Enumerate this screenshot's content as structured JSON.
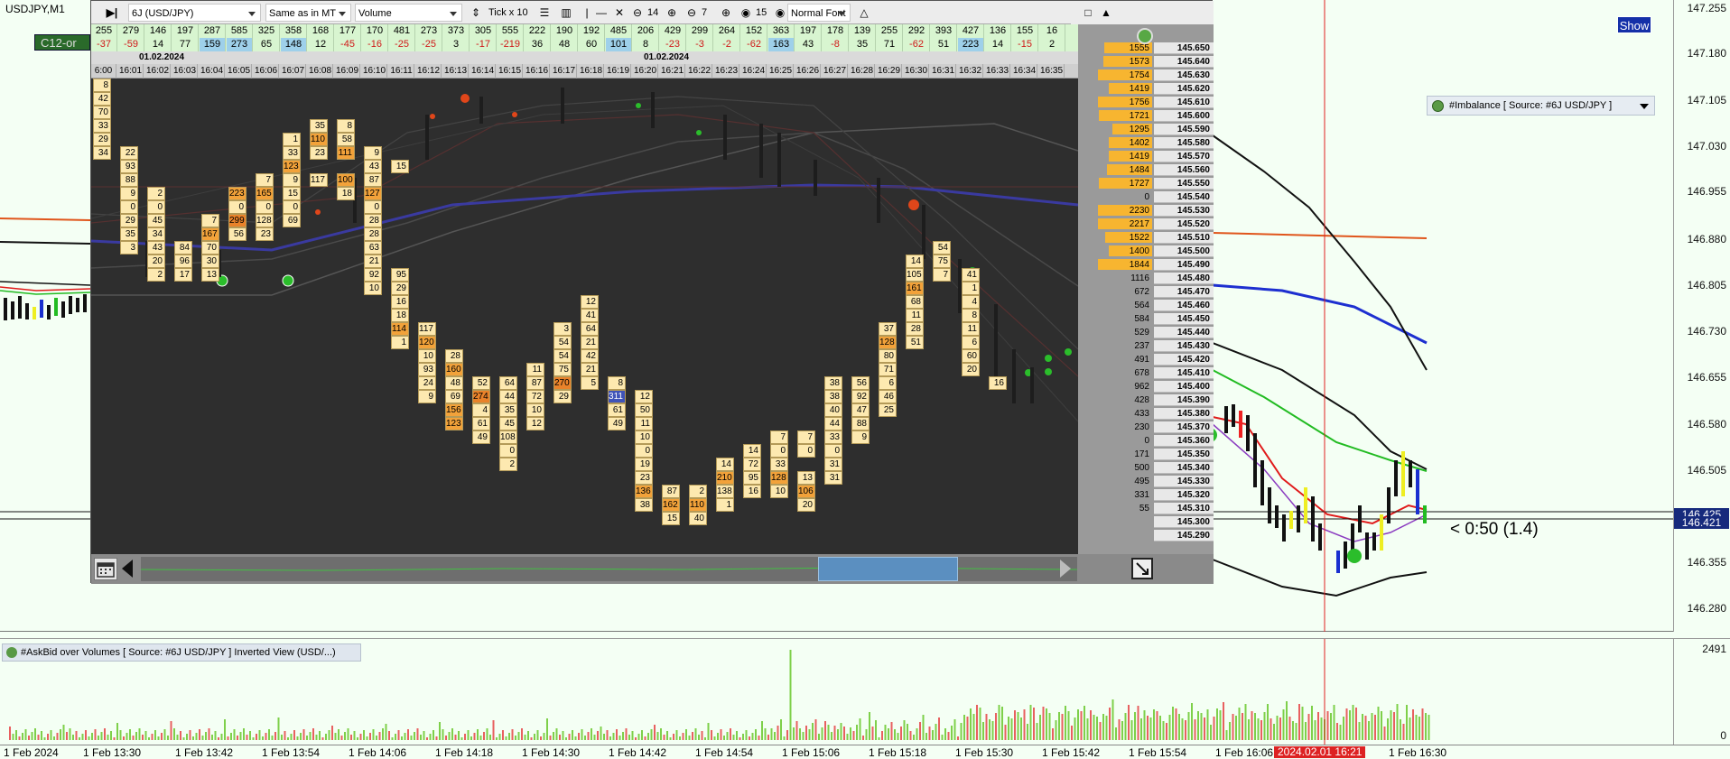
{
  "main": {
    "symbol_title": "USDJPY,M1",
    "show_button": "Show",
    "timer_text": "< 0:50 (1.4)",
    "price_labels": [
      "147.255",
      "147.180",
      "147.105",
      "147.030",
      "146.955",
      "146.880",
      "146.805",
      "146.730",
      "146.655",
      "146.580",
      "146.505",
      "146.425",
      "146.421",
      "146.355",
      "146.280"
    ],
    "bid_tags": [
      "146.425",
      "146.421"
    ],
    "imbalance_title": "#Imbalance [ Source: #6J USD/JPY ]"
  },
  "toolbar": {
    "instrument": "6J (USD/JPY)",
    "scale_mode": "Same as in MT",
    "data_type": "Volume",
    "tick_mode": "Tick x 10",
    "zoom_value": "14",
    "step_value": "7",
    "count_value": "15",
    "font_mode": "Normal Font"
  },
  "stats": {
    "row1": [
      "255",
      "279",
      "146",
      "197",
      "287",
      "585",
      "325",
      "358",
      "168",
      "177",
      "170",
      "481",
      "273",
      "373",
      "305",
      "555",
      "222",
      "190",
      "192",
      "485",
      "206",
      "429",
      "299",
      "264",
      "152",
      "363",
      "197",
      "178",
      "139",
      "255",
      "292",
      "393",
      "427",
      "136",
      "155",
      "16"
    ],
    "row2": [
      "-37",
      "-59",
      "14",
      "77",
      "159",
      "273",
      "65",
      "148",
      "12",
      "-45",
      "-16",
      "-25",
      "-25",
      "3",
      "-17",
      "-219",
      "36",
      "48",
      "60",
      "101",
      "8",
      "-23",
      "-3",
      "-2",
      "-62",
      "163",
      "43",
      "-8",
      "35",
      "71",
      "-62",
      "51",
      "223",
      "14",
      "-15",
      "2"
    ],
    "c12_label": "C12-or"
  },
  "dates": {
    "d1": "01.02.2024",
    "d2": "01.02.2024"
  },
  "times": [
    "6:00",
    "16:01",
    "16:02",
    "16:03",
    "16:04",
    "16:05",
    "16:06",
    "16:07",
    "16:08",
    "16:09",
    "16:10",
    "16:11",
    "16:12",
    "16:13",
    "16:14",
    "16:15",
    "16:16",
    "16:17",
    "16:18",
    "16:19",
    "16:20",
    "16:21",
    "16:22",
    "16:23",
    "16:24",
    "16:25",
    "16:26",
    "16:27",
    "16:28",
    "16:29",
    "16:30",
    "16:31",
    "16:32",
    "16:33",
    "16:34",
    "16:35"
  ],
  "ladder": [
    {
      "vol": "1555",
      "price": "145.650",
      "bar": 0.88
    },
    {
      "vol": "1573",
      "price": "145.640",
      "bar": 0.9
    },
    {
      "vol": "1754",
      "price": "145.630",
      "bar": 1.0
    },
    {
      "vol": "1419",
      "price": "145.620",
      "bar": 0.8
    },
    {
      "vol": "1756",
      "price": "145.610",
      "bar": 1.0
    },
    {
      "vol": "1721",
      "price": "145.600",
      "bar": 0.98
    },
    {
      "vol": "1295",
      "price": "145.590",
      "bar": 0.74
    },
    {
      "vol": "1402",
      "price": "145.580",
      "bar": 0.8
    },
    {
      "vol": "1419",
      "price": "145.570",
      "bar": 0.8
    },
    {
      "vol": "1484",
      "price": "145.560",
      "bar": 0.84
    },
    {
      "vol": "1727",
      "price": "145.550",
      "bar": 0.98
    },
    {
      "vol": "0",
      "price": "145.540",
      "bar": 0
    },
    {
      "vol": "2230",
      "price": "145.530",
      "bar": 1.0
    },
    {
      "vol": "2217",
      "price": "145.520",
      "bar": 1.0
    },
    {
      "vol": "1522",
      "price": "145.510",
      "bar": 0.86
    },
    {
      "vol": "1400",
      "price": "145.500",
      "bar": 0.8
    },
    {
      "vol": "1844",
      "price": "145.490",
      "bar": 1.0
    },
    {
      "vol": "1116",
      "price": "145.480",
      "bar": 0
    },
    {
      "vol": "672",
      "price": "145.470",
      "bar": 0
    },
    {
      "vol": "564",
      "price": "145.460",
      "bar": 0
    },
    {
      "vol": "584",
      "price": "145.450",
      "bar": 0
    },
    {
      "vol": "529",
      "price": "145.440",
      "bar": 0
    },
    {
      "vol": "237",
      "price": "145.430",
      "bar": 0
    },
    {
      "vol": "491",
      "price": "145.420",
      "bar": 0
    },
    {
      "vol": "678",
      "price": "145.410",
      "bar": 0
    },
    {
      "vol": "962",
      "price": "145.400",
      "bar": 0
    },
    {
      "vol": "428",
      "price": "145.390",
      "bar": 0
    },
    {
      "vol": "433",
      "price": "145.380",
      "bar": 0
    },
    {
      "vol": "230",
      "price": "145.370",
      "bar": 0
    },
    {
      "vol": "0",
      "price": "145.360",
      "bar": 0
    },
    {
      "vol": "171",
      "price": "145.350",
      "bar": 0
    },
    {
      "vol": "500",
      "price": "145.340",
      "bar": 0
    },
    {
      "vol": "495",
      "price": "145.330",
      "bar": 0
    },
    {
      "vol": "331",
      "price": "145.320",
      "bar": 0
    },
    {
      "vol": "55",
      "price": "145.310",
      "bar": 0
    },
    {
      "vol": "",
      "price": "145.300",
      "bar": 0
    },
    {
      "vol": "",
      "price": "145.290",
      "bar": 0
    }
  ],
  "footprint_cells": [
    {
      "c": 0,
      "r": 0,
      "v": "8"
    },
    {
      "c": 0,
      "r": 1,
      "v": "42"
    },
    {
      "c": 0,
      "r": 2,
      "v": "70"
    },
    {
      "c": 0,
      "r": 3,
      "v": "33"
    },
    {
      "c": 0,
      "r": 4,
      "v": "29"
    },
    {
      "c": 0,
      "r": 5,
      "v": "34"
    },
    {
      "c": 1,
      "r": 5,
      "v": "22"
    },
    {
      "c": 1,
      "r": 6,
      "v": "93"
    },
    {
      "c": 1,
      "r": 7,
      "v": "88"
    },
    {
      "c": 1,
      "r": 8,
      "v": "9"
    },
    {
      "c": 1,
      "r": 9,
      "v": "0"
    },
    {
      "c": 1,
      "r": 10,
      "v": "29"
    },
    {
      "c": 1,
      "r": 11,
      "v": "35"
    },
    {
      "c": 1,
      "r": 12,
      "v": "3"
    },
    {
      "c": 2,
      "r": 8,
      "v": "2"
    },
    {
      "c": 2,
      "r": 9,
      "v": "0"
    },
    {
      "c": 2,
      "r": 10,
      "v": "45"
    },
    {
      "c": 2,
      "r": 11,
      "v": "34"
    },
    {
      "c": 2,
      "r": 12,
      "v": "43"
    },
    {
      "c": 2,
      "r": 13,
      "v": "20"
    },
    {
      "c": 2,
      "r": 14,
      "v": "2"
    },
    {
      "c": 3,
      "r": 12,
      "v": "84"
    },
    {
      "c": 3,
      "r": 13,
      "v": "96"
    },
    {
      "c": 3,
      "r": 14,
      "v": "17"
    },
    {
      "c": 4,
      "r": 10,
      "v": "7"
    },
    {
      "c": 4,
      "r": 11,
      "v": "167",
      "h": 1
    },
    {
      "c": 4,
      "r": 12,
      "v": "70"
    },
    {
      "c": 4,
      "r": 13,
      "v": "30"
    },
    {
      "c": 4,
      "r": 14,
      "v": "13"
    },
    {
      "c": 5,
      "r": 8,
      "v": "223",
      "h": 1
    },
    {
      "c": 5,
      "r": 9,
      "v": "0"
    },
    {
      "c": 5,
      "r": 10,
      "v": "299",
      "h": 2
    },
    {
      "c": 5,
      "r": 11,
      "v": "56"
    },
    {
      "c": 6,
      "r": 7,
      "v": "7"
    },
    {
      "c": 6,
      "r": 8,
      "v": "165",
      "h": 1
    },
    {
      "c": 6,
      "r": 9,
      "v": "0"
    },
    {
      "c": 6,
      "r": 10,
      "v": "128"
    },
    {
      "c": 6,
      "r": 11,
      "v": "23"
    },
    {
      "c": 7,
      "r": 4,
      "v": "1"
    },
    {
      "c": 7,
      "r": 5,
      "v": "33"
    },
    {
      "c": 7,
      "r": 6,
      "v": "123",
      "h": 1
    },
    {
      "c": 7,
      "r": 7,
      "v": "9"
    },
    {
      "c": 7,
      "r": 8,
      "v": "15"
    },
    {
      "c": 7,
      "r": 9,
      "v": "0"
    },
    {
      "c": 7,
      "r": 10,
      "v": "69"
    },
    {
      "c": 8,
      "r": 3,
      "v": "35"
    },
    {
      "c": 8,
      "r": 4,
      "v": "110",
      "h": 1
    },
    {
      "c": 8,
      "r": 5,
      "v": "23"
    },
    {
      "c": 8,
      "r": 7,
      "v": "117"
    },
    {
      "c": 9,
      "r": 3,
      "v": "8"
    },
    {
      "c": 9,
      "r": 4,
      "v": "58"
    },
    {
      "c": 9,
      "r": 5,
      "v": "111",
      "h": 1
    },
    {
      "c": 9,
      "r": 7,
      "v": "100",
      "h": 1
    },
    {
      "c": 9,
      "r": 8,
      "v": "18"
    },
    {
      "c": 10,
      "r": 5,
      "v": "9"
    },
    {
      "c": 10,
      "r": 6,
      "v": "43"
    },
    {
      "c": 10,
      "r": 7,
      "v": "87"
    },
    {
      "c": 10,
      "r": 8,
      "v": "127",
      "h": 1
    },
    {
      "c": 10,
      "r": 9,
      "v": "0"
    },
    {
      "c": 10,
      "r": 10,
      "v": "28"
    },
    {
      "c": 10,
      "r": 11,
      "v": "28"
    },
    {
      "c": 10,
      "r": 12,
      "v": "63"
    },
    {
      "c": 10,
      "r": 13,
      "v": "21"
    },
    {
      "c": 10,
      "r": 14,
      "v": "92"
    },
    {
      "c": 10,
      "r": 15,
      "v": "10"
    },
    {
      "c": 11,
      "r": 6,
      "v": "15"
    },
    {
      "c": 11,
      "r": 14,
      "v": "95"
    },
    {
      "c": 11,
      "r": 15,
      "v": "29"
    },
    {
      "c": 11,
      "r": 16,
      "v": "16"
    },
    {
      "c": 11,
      "r": 17,
      "v": "18"
    },
    {
      "c": 11,
      "r": 18,
      "v": "114",
      "h": 1
    },
    {
      "c": 11,
      "r": 19,
      "v": "1"
    },
    {
      "c": 12,
      "r": 18,
      "v": "117"
    },
    {
      "c": 12,
      "r": 19,
      "v": "120",
      "h": 1
    },
    {
      "c": 12,
      "r": 20,
      "v": "10"
    },
    {
      "c": 12,
      "r": 21,
      "v": "93"
    },
    {
      "c": 12,
      "r": 22,
      "v": "24"
    },
    {
      "c": 12,
      "r": 23,
      "v": "9"
    },
    {
      "c": 13,
      "r": 20,
      "v": "28"
    },
    {
      "c": 13,
      "r": 21,
      "v": "160",
      "h": 1
    },
    {
      "c": 13,
      "r": 22,
      "v": "48"
    },
    {
      "c": 13,
      "r": 23,
      "v": "69"
    },
    {
      "c": 13,
      "r": 24,
      "v": "156",
      "h": 1
    },
    {
      "c": 13,
      "r": 25,
      "v": "123",
      "h": 1
    },
    {
      "c": 14,
      "r": 22,
      "v": "52"
    },
    {
      "c": 14,
      "r": 23,
      "v": "274",
      "h": 2
    },
    {
      "c": 14,
      "r": 24,
      "v": "4"
    },
    {
      "c": 14,
      "r": 25,
      "v": "61"
    },
    {
      "c": 14,
      "r": 26,
      "v": "49"
    },
    {
      "c": 15,
      "r": 22,
      "v": "64"
    },
    {
      "c": 15,
      "r": 23,
      "v": "44"
    },
    {
      "c": 15,
      "r": 24,
      "v": "35"
    },
    {
      "c": 15,
      "r": 25,
      "v": "45"
    },
    {
      "c": 15,
      "r": 26,
      "v": "108"
    },
    {
      "c": 15,
      "r": 27,
      "v": "0"
    },
    {
      "c": 15,
      "r": 28,
      "v": "2"
    },
    {
      "c": 16,
      "r": 21,
      "v": "11"
    },
    {
      "c": 16,
      "r": 22,
      "v": "87"
    },
    {
      "c": 16,
      "r": 23,
      "v": "72"
    },
    {
      "c": 16,
      "r": 24,
      "v": "10"
    },
    {
      "c": 16,
      "r": 25,
      "v": "12"
    },
    {
      "c": 17,
      "r": 18,
      "v": "3"
    },
    {
      "c": 17,
      "r": 19,
      "v": "54"
    },
    {
      "c": 17,
      "r": 20,
      "v": "54"
    },
    {
      "c": 17,
      "r": 21,
      "v": "75"
    },
    {
      "c": 17,
      "r": 22,
      "v": "270",
      "h": 2
    },
    {
      "c": 17,
      "r": 23,
      "v": "29"
    },
    {
      "c": 18,
      "r": 16,
      "v": "12"
    },
    {
      "c": 18,
      "r": 17,
      "v": "41"
    },
    {
      "c": 18,
      "r": 18,
      "v": "64"
    },
    {
      "c": 18,
      "r": 19,
      "v": "21"
    },
    {
      "c": 18,
      "r": 20,
      "v": "42"
    },
    {
      "c": 18,
      "r": 21,
      "v": "21"
    },
    {
      "c": 18,
      "r": 22,
      "v": "5"
    },
    {
      "c": 19,
      "r": 22,
      "v": "8"
    },
    {
      "c": 19,
      "r": 23,
      "v": "311",
      "h": 3
    },
    {
      "c": 19,
      "r": 24,
      "v": "61"
    },
    {
      "c": 19,
      "r": 25,
      "v": "49"
    },
    {
      "c": 20,
      "r": 23,
      "v": "12"
    },
    {
      "c": 20,
      "r": 24,
      "v": "50"
    },
    {
      "c": 20,
      "r": 25,
      "v": "11"
    },
    {
      "c": 20,
      "r": 26,
      "v": "10"
    },
    {
      "c": 20,
      "r": 27,
      "v": "0"
    },
    {
      "c": 20,
      "r": 28,
      "v": "19"
    },
    {
      "c": 20,
      "r": 29,
      "v": "23"
    },
    {
      "c": 20,
      "r": 30,
      "v": "136",
      "h": 1
    },
    {
      "c": 20,
      "r": 31,
      "v": "38"
    },
    {
      "c": 21,
      "r": 30,
      "v": "87"
    },
    {
      "c": 21,
      "r": 31,
      "v": "162",
      "h": 1
    },
    {
      "c": 21,
      "r": 32,
      "v": "15"
    },
    {
      "c": 22,
      "r": 30,
      "v": "2"
    },
    {
      "c": 22,
      "r": 31,
      "v": "110",
      "h": 1
    },
    {
      "c": 22,
      "r": 32,
      "v": "40"
    },
    {
      "c": 23,
      "r": 28,
      "v": "14"
    },
    {
      "c": 23,
      "r": 29,
      "v": "210",
      "h": 1
    },
    {
      "c": 23,
      "r": 30,
      "v": "138"
    },
    {
      "c": 23,
      "r": 31,
      "v": "1"
    },
    {
      "c": 24,
      "r": 27,
      "v": "14"
    },
    {
      "c": 24,
      "r": 28,
      "v": "72"
    },
    {
      "c": 24,
      "r": 29,
      "v": "95"
    },
    {
      "c": 24,
      "r": 30,
      "v": "16"
    },
    {
      "c": 25,
      "r": 26,
      "v": "7"
    },
    {
      "c": 25,
      "r": 27,
      "v": "0"
    },
    {
      "c": 25,
      "r": 28,
      "v": "33"
    },
    {
      "c": 25,
      "r": 29,
      "v": "128",
      "h": 1
    },
    {
      "c": 25,
      "r": 30,
      "v": "10"
    },
    {
      "c": 26,
      "r": 26,
      "v": "7"
    },
    {
      "c": 26,
      "r": 27,
      "v": "0"
    },
    {
      "c": 26,
      "r": 29,
      "v": "13"
    },
    {
      "c": 26,
      "r": 30,
      "v": "106",
      "h": 1
    },
    {
      "c": 26,
      "r": 31,
      "v": "20"
    },
    {
      "c": 27,
      "r": 22,
      "v": "38"
    },
    {
      "c": 27,
      "r": 23,
      "v": "38"
    },
    {
      "c": 27,
      "r": 24,
      "v": "40"
    },
    {
      "c": 27,
      "r": 25,
      "v": "44"
    },
    {
      "c": 27,
      "r": 26,
      "v": "33"
    },
    {
      "c": 27,
      "r": 27,
      "v": "0"
    },
    {
      "c": 27,
      "r": 28,
      "v": "31"
    },
    {
      "c": 27,
      "r": 29,
      "v": "31"
    },
    {
      "c": 28,
      "r": 22,
      "v": "56"
    },
    {
      "c": 28,
      "r": 23,
      "v": "92"
    },
    {
      "c": 28,
      "r": 24,
      "v": "47"
    },
    {
      "c": 28,
      "r": 25,
      "v": "88"
    },
    {
      "c": 28,
      "r": 26,
      "v": "9"
    },
    {
      "c": 29,
      "r": 18,
      "v": "37"
    },
    {
      "c": 29,
      "r": 19,
      "v": "128",
      "h": 1
    },
    {
      "c": 29,
      "r": 20,
      "v": "80"
    },
    {
      "c": 29,
      "r": 21,
      "v": "71"
    },
    {
      "c": 29,
      "r": 22,
      "v": "6"
    },
    {
      "c": 29,
      "r": 23,
      "v": "46"
    },
    {
      "c": 29,
      "r": 24,
      "v": "25"
    },
    {
      "c": 30,
      "r": 13,
      "v": "14"
    },
    {
      "c": 30,
      "r": 14,
      "v": "105"
    },
    {
      "c": 30,
      "r": 15,
      "v": "161",
      "h": 1
    },
    {
      "c": 30,
      "r": 16,
      "v": "68"
    },
    {
      "c": 30,
      "r": 17,
      "v": "11"
    },
    {
      "c": 30,
      "r": 18,
      "v": "28"
    },
    {
      "c": 30,
      "r": 19,
      "v": "51"
    },
    {
      "c": 31,
      "r": 12,
      "v": "54"
    },
    {
      "c": 31,
      "r": 13,
      "v": "75"
    },
    {
      "c": 31,
      "r": 14,
      "v": "7"
    },
    {
      "c": 32,
      "r": 14,
      "v": "41"
    },
    {
      "c": 32,
      "r": 15,
      "v": "1"
    },
    {
      "c": 32,
      "r": 16,
      "v": "4"
    },
    {
      "c": 32,
      "r": 17,
      "v": "8"
    },
    {
      "c": 32,
      "r": 18,
      "v": "11"
    },
    {
      "c": 32,
      "r": 19,
      "v": "6"
    },
    {
      "c": 32,
      "r": 20,
      "v": "60"
    },
    {
      "c": 32,
      "r": 21,
      "v": "20"
    },
    {
      "c": 33,
      "r": 22,
      "v": "16"
    }
  ],
  "lower": {
    "askbid_title": "#AskBid over Volumes [ Source: #6J USD/JPY ] Inverted View (USD/...)",
    "axis_top": "2491",
    "axis_bottom": "0"
  },
  "time_axis": [
    "1 Feb 2024",
    "1 Feb 13:30",
    "1 Feb 13:42",
    "1 Feb 13:54",
    "1 Feb 14:06",
    "1 Feb 14:18",
    "1 Feb 14:30",
    "1 Feb 14:42",
    "1 Feb 14:54",
    "1 Feb 15:06",
    "1 Feb 15:18",
    "1 Feb 15:30",
    "1 Feb 15:42",
    "1 Feb 15:54",
    "1 Feb 16:06",
    "1 Feb 16:30"
  ],
  "cursor_time": "2024.02.01 16:21",
  "colors": {
    "accent_blue": "#1430a8",
    "cursor_red": "#d22222",
    "ladder_bar": "#f7b530",
    "footprint_cell": "#fde9b0"
  }
}
